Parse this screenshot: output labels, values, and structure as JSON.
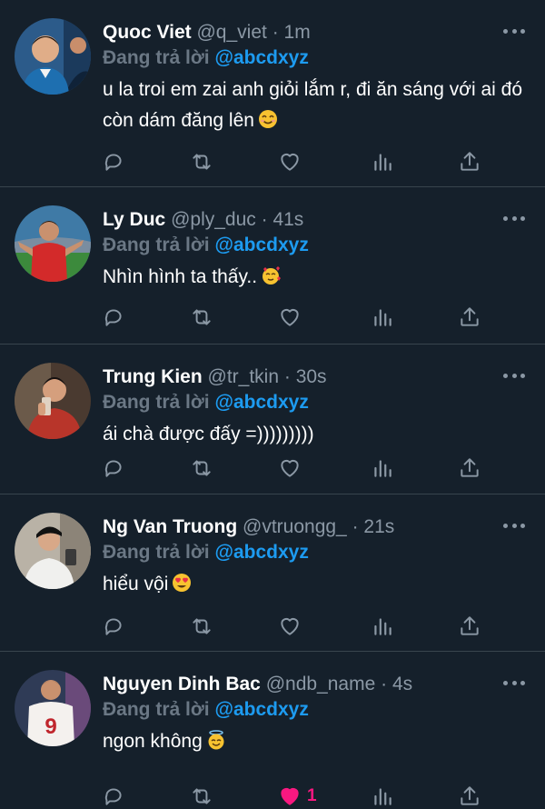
{
  "colors": {
    "background": "#15202b",
    "divider": "#38444d",
    "muted": "#8b98a5",
    "link": "#1d9bf0",
    "like_active": "#f91880"
  },
  "reply_prefix": "Đang trả lời",
  "replied_to": "@abcdxyz",
  "tweets": [
    {
      "name": "Quoc Viet",
      "handle": "@q_viet",
      "time": "· 1m",
      "text": "u la troi em zai anh giỏi lắm r, đi ăn sáng với ai đó còn dám đăng lên",
      "emoji": "smiling-face-icon",
      "liked": false,
      "like_count": ""
    },
    {
      "name": "Ly Duc",
      "handle": "@ply_duc",
      "time": "· 41s",
      "text": "Nhìn hình ta thấy..",
      "emoji": "face-with-hearts-icon",
      "liked": false,
      "like_count": ""
    },
    {
      "name": "Trung Kien",
      "handle": "@tr_tkin",
      "time": "· 30s",
      "text": "ái chà được đấy =)))))))))",
      "emoji": "",
      "liked": false,
      "like_count": ""
    },
    {
      "name": "Ng Van Truong",
      "handle": "@vtruongg_",
      "time": "· 21s",
      "text": "hiểu vội",
      "emoji": "heart-eyes-icon",
      "liked": false,
      "like_count": ""
    },
    {
      "name": "Nguyen Dinh Bac",
      "handle": "@ndb_name",
      "time": "· 4s",
      "text": "ngon không",
      "emoji": "halo-face-icon",
      "liked": true,
      "like_count": "1"
    }
  ]
}
